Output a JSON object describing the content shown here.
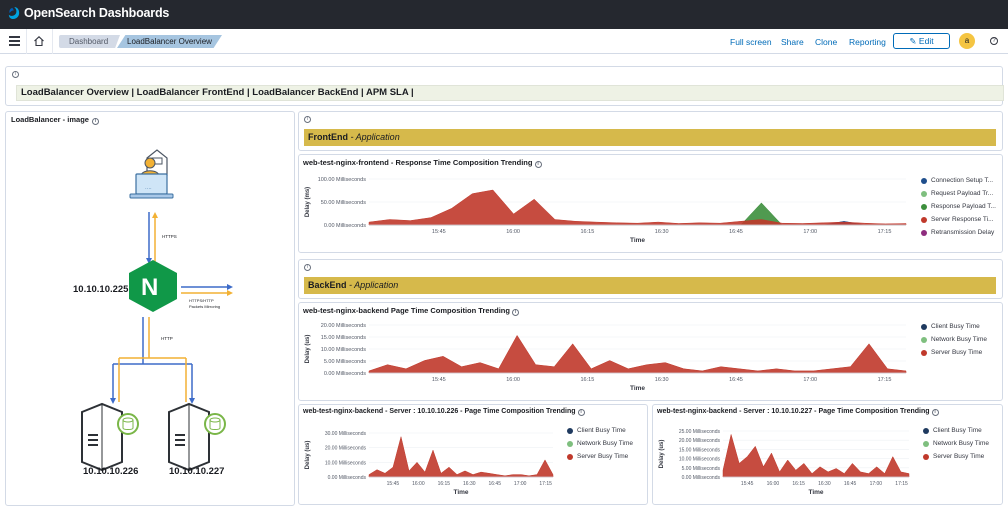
{
  "app": {
    "title": "OpenSearch Dashboards"
  },
  "breadcrumbs": [
    "Dashboard",
    "LoadBalancer Overview"
  ],
  "nav": {
    "full_screen": "Full screen",
    "share": "Share",
    "clone": "Clone",
    "reporting": "Reporting",
    "edit": "Edit",
    "avatar": "a"
  },
  "markdown": {
    "links": "LoadBalancer Overview | LoadBalancer FrontEnd | LoadBalancer BackEnd | APM SLA |"
  },
  "image_panel": {
    "title": "LoadBalancer - image",
    "lb_ip": "10.10.10.225",
    "label_https": "HTTPS",
    "label_http": "HTTP",
    "label_mirror": "HTTPS/HTTP Packets Mirroring",
    "server1_ip": "10.10.10.226",
    "server2_ip": "10.10.10.227",
    "logo_letter": "N"
  },
  "sections": {
    "frontend": {
      "name": "FrontEnd",
      "subtitle": " - Application"
    },
    "backend": {
      "name": "BackEnd",
      "subtitle": " - Application"
    }
  },
  "chart_data": [
    {
      "title": "web-test-nginx-frontend - Response Time Composition Trending",
      "type": "area",
      "xlabel": "Time",
      "ylabel": "Delay (ms)",
      "ytick_labels": [
        "100.00 Milliseconds",
        "50.00 Milliseconds",
        "0.00 Milliseconds"
      ],
      "xtick_labels": [
        "15:45",
        "16:00",
        "16:15",
        "16:30",
        "16:45",
        "17:00",
        "17:15"
      ],
      "x": [
        "15:30",
        "15:35",
        "15:40",
        "15:42",
        "15:45",
        "15:50",
        "15:53",
        "15:55",
        "15:58",
        "16:00",
        "16:05",
        "16:10",
        "16:15",
        "16:20",
        "16:25",
        "16:30",
        "16:35",
        "16:40",
        "16:44",
        "16:46",
        "16:50",
        "17:00",
        "17:10",
        "17:14",
        "17:16",
        "17:20",
        "17:25"
      ],
      "ylim": [
        0,
        125
      ],
      "series": [
        {
          "name": "Connection Setup T...",
          "color": "#1f4e8c",
          "values": [
            0,
            0,
            0,
            0,
            0,
            0,
            0,
            0,
            0,
            0,
            0,
            0,
            0,
            0,
            0,
            0,
            0,
            0,
            0,
            0,
            0,
            0,
            0,
            10,
            0,
            0,
            0
          ]
        },
        {
          "name": "Request Payload Tr...",
          "color": "#7fbf7f",
          "values": [
            0,
            0,
            0,
            0,
            0,
            0,
            0,
            0,
            0,
            0,
            0,
            0,
            0,
            0,
            0,
            0,
            0,
            0,
            0,
            0,
            0,
            0,
            0,
            0,
            0,
            0,
            0
          ]
        },
        {
          "name": "Response Payload T...",
          "color": "#3d8f3d",
          "values": [
            0,
            0,
            0,
            0,
            0,
            0,
            0,
            0,
            0,
            0,
            0,
            0,
            0,
            0,
            0,
            0,
            0,
            0,
            0,
            60,
            0,
            0,
            0,
            0,
            0,
            0,
            0
          ]
        },
        {
          "name": "Server Response Ti...",
          "color": "#c0392b",
          "values": [
            8,
            15,
            12,
            20,
            45,
            85,
            95,
            30,
            70,
            15,
            10,
            8,
            6,
            5,
            8,
            4,
            6,
            5,
            10,
            15,
            5,
            4,
            6,
            8,
            5,
            3,
            4
          ]
        },
        {
          "name": "Retransmission Delay",
          "color": "#8e2d7e",
          "values": [
            0,
            0,
            0,
            0,
            0,
            0,
            0,
            0,
            0,
            0,
            0,
            0,
            0,
            0,
            0,
            0,
            0,
            0,
            0,
            0,
            0,
            0,
            0,
            0,
            0,
            0,
            0
          ]
        }
      ]
    },
    {
      "title": "web-test-nginx-backend Page Time Composition Trending",
      "type": "area",
      "xlabel": "Time",
      "ylabel": "Delay (us)",
      "ytick_labels": [
        "20.00 Milliseconds",
        "15.00 Milliseconds",
        "10.00 Milliseconds",
        "5.00 Milliseconds",
        "0.00 Milliseconds"
      ],
      "xtick_labels": [
        "15:45",
        "16:00",
        "16:15",
        "16:30",
        "16:45",
        "17:00",
        "17:15"
      ],
      "ylim": [
        0,
        23
      ],
      "series": [
        {
          "name": "Client Busy Time",
          "color": "#1f3a5f",
          "values": [
            0,
            0,
            0,
            0,
            0,
            0,
            0,
            0,
            0,
            0,
            0,
            0,
            0,
            0,
            0,
            0,
            0,
            0,
            0,
            0,
            0,
            0,
            0,
            0,
            0,
            0,
            0,
            0,
            0,
            0
          ]
        },
        {
          "name": "Network Busy Time",
          "color": "#7fbf7f",
          "values": [
            0,
            0,
            0,
            0,
            0,
            0,
            0,
            0,
            0,
            0,
            0,
            0,
            0,
            0,
            0,
            0,
            0,
            0,
            0,
            0,
            0,
            0,
            0,
            0,
            0,
            0,
            0,
            0,
            0,
            0
          ]
        },
        {
          "name": "Server Busy Time",
          "color": "#c0392b",
          "values": [
            1,
            4,
            2,
            6,
            8,
            3,
            5,
            2,
            18,
            4,
            3,
            14,
            2,
            6,
            2,
            4,
            5,
            2,
            1,
            3,
            2,
            1,
            2,
            1,
            1,
            2,
            3,
            14,
            2,
            1
          ]
        }
      ]
    },
    {
      "title": "web-test-nginx-backend - Server : 10.10.10.226 - Page Time Composition Trending",
      "type": "area",
      "xlabel": "Time",
      "ylabel": "Delay (us)",
      "ytick_labels": [
        "30.00 Milliseconds",
        "20.00 Milliseconds",
        "10.00 Milliseconds",
        "0.00 Milliseconds"
      ],
      "xtick_labels": [
        "15:45",
        "16:00",
        "16:15",
        "16:30",
        "16:45",
        "17:00",
        "17:15"
      ],
      "ylim": [
        0,
        36
      ],
      "series": [
        {
          "name": "Client Busy Time",
          "color": "#1f3a5f",
          "values": [
            0,
            0,
            0,
            0,
            0,
            0,
            0,
            0,
            0,
            0,
            0,
            0,
            0,
            0,
            0,
            0,
            0,
            0,
            0,
            0,
            0,
            0,
            0,
            0
          ]
        },
        {
          "name": "Network Busy Time",
          "color": "#7fbf7f",
          "values": [
            0,
            0,
            0,
            0,
            0,
            0,
            0,
            0,
            0,
            0,
            0,
            0,
            0,
            0,
            0,
            0,
            0,
            0,
            0,
            0,
            0,
            0,
            0,
            0
          ]
        },
        {
          "name": "Server Busy Time",
          "color": "#c0392b",
          "values": [
            2,
            6,
            3,
            8,
            33,
            5,
            12,
            4,
            22,
            3,
            8,
            2,
            5,
            2,
            4,
            3,
            2,
            1,
            2,
            2,
            1,
            2,
            14,
            2
          ]
        }
      ]
    },
    {
      "title": "web-test-nginx-backend - Server : 10.10.10.227 - Page Time Composition Trending",
      "type": "area",
      "xlabel": "Time",
      "ylabel": "Delay (us)",
      "ytick_labels": [
        "25.00 Milliseconds",
        "20.00 Milliseconds",
        "15.00 Milliseconds",
        "10.00 Milliseconds",
        "5.00 Milliseconds",
        "0.00 Milliseconds"
      ],
      "xtick_labels": [
        "15:45",
        "16:00",
        "16:15",
        "16:30",
        "16:45",
        "17:00",
        "17:15"
      ],
      "ylim": [
        0,
        27
      ],
      "series": [
        {
          "name": "Client Busy Time",
          "color": "#1f3a5f",
          "values": [
            0,
            0,
            0,
            0,
            0,
            0,
            0,
            0,
            0,
            0,
            0,
            0,
            0,
            0,
            0,
            0,
            0,
            0,
            0,
            0,
            0,
            0,
            0,
            0
          ]
        },
        {
          "name": "Network Busy Time",
          "color": "#7fbf7f",
          "values": [
            0,
            0,
            0,
            0,
            0,
            0,
            0,
            0,
            0,
            0,
            0,
            0,
            0,
            0,
            0,
            0,
            0,
            0,
            0,
            0,
            0,
            0,
            0,
            0
          ]
        },
        {
          "name": "Server Busy Time",
          "color": "#c0392b",
          "values": [
            4,
            25,
            8,
            12,
            18,
            6,
            14,
            3,
            10,
            4,
            8,
            2,
            6,
            3,
            5,
            2,
            8,
            3,
            2,
            6,
            2,
            12,
            3,
            2
          ]
        }
      ]
    }
  ]
}
